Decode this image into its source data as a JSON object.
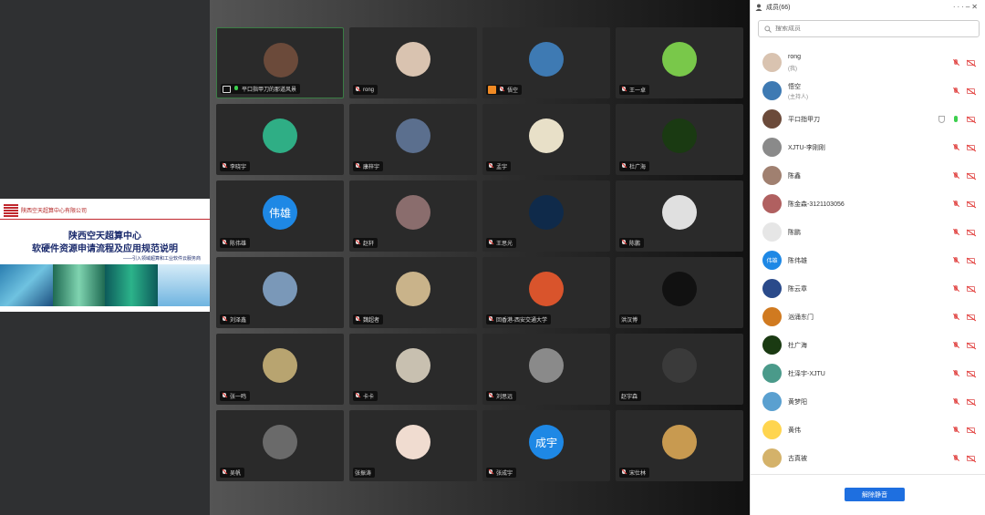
{
  "slide": {
    "company": "陕西空天超算中心有限公司",
    "title_line1": "陕西空天超算中心",
    "title_line2": "软硬件资源申请流程及应用规范说明",
    "subtitle": "——引入领域超算和工业软件云服务商"
  },
  "video_grid": {
    "tiles": [
      {
        "name": "平口指甲刀的那道风景",
        "avatar_bg": "#6b4a3a",
        "active": true,
        "pc_badge": true,
        "mic": "on"
      },
      {
        "name": "rong",
        "avatar_bg": "#d9c3b0",
        "mic": "off"
      },
      {
        "name": "悟空",
        "avatar_bg": "#3e7ab3",
        "orange_badge": true,
        "mic": "off"
      },
      {
        "name": "王一卓",
        "avatar_bg": "#79c84a",
        "mic": "off"
      },
      {
        "name": "李晓宇",
        "avatar_bg": "#2fae85",
        "mic": "off"
      },
      {
        "name": "康梓宇",
        "avatar_bg": "#5b6f8e",
        "mic": "off"
      },
      {
        "name": "孟宇",
        "avatar_bg": "#e8e0c8",
        "mic": "off"
      },
      {
        "name": "杜广海",
        "avatar_bg": "#1a3a12",
        "mic": "off"
      },
      {
        "name": "陈伟雄",
        "avatar_bg": "#1e88e5",
        "avatar_text": "伟雄",
        "mic": "off"
      },
      {
        "name": "赵轩",
        "avatar_bg": "#8a6d6d",
        "mic": "off"
      },
      {
        "name": "王思光",
        "avatar_bg": "#0f2a4a",
        "mic": "off"
      },
      {
        "name": "陈鹏",
        "avatar_bg": "#e0e0e0",
        "mic": "off"
      },
      {
        "name": "刘泽鑫",
        "avatar_bg": "#7a98b8",
        "mic": "off"
      },
      {
        "name": "魏超者",
        "avatar_bg": "#c9b38a",
        "mic": "off"
      },
      {
        "name": "回香港-西安交通大学",
        "avatar_bg": "#d9542c",
        "mic": "off"
      },
      {
        "name": "洪汉博",
        "avatar_bg": "#111111",
        "mic": "none"
      },
      {
        "name": "张一鸣",
        "avatar_bg": "#b8a470",
        "mic": "off"
      },
      {
        "name": "卡卡",
        "avatar_bg": "#c8c0b0",
        "mic": "off"
      },
      {
        "name": "刘思远",
        "avatar_bg": "#8a8a8a",
        "mic": "off"
      },
      {
        "name": "赵宇森",
        "avatar_bg": "#3a3a3a",
        "mic": "none"
      },
      {
        "name": "吴帆",
        "avatar_bg": "#6a6a6a",
        "mic": "off"
      },
      {
        "name": "张振涛",
        "avatar_bg": "#f0dcd0",
        "mic": "none"
      },
      {
        "name": "张成宇",
        "avatar_bg": "#1e88e5",
        "avatar_text": "成宇",
        "mic": "off"
      },
      {
        "name": "宋仕林",
        "avatar_bg": "#c89a50",
        "mic": "off"
      }
    ]
  },
  "members_panel": {
    "title": "成员(66)",
    "search_placeholder": "搜索成员",
    "members": [
      {
        "name": "rong",
        "sub": "(我)",
        "avatar_bg": "#d9c3b0"
      },
      {
        "name": "悟空",
        "sub": "(主持人)",
        "avatar_bg": "#3e7ab3"
      },
      {
        "name": "平口指甲刀",
        "avatar_bg": "#6b4a3a",
        "speaking": true
      },
      {
        "name": "XJTU-李刚刚",
        "avatar_bg": "#8a8a8a"
      },
      {
        "name": "陈鑫",
        "avatar_bg": "#a08070"
      },
      {
        "name": "陈金森-3121103056",
        "avatar_bg": "#b06060"
      },
      {
        "name": "陈鹏",
        "avatar_bg": "#e6e6e6"
      },
      {
        "name": "陈伟雄",
        "avatar_bg": "#1e88e5",
        "avatar_text": "伟雄"
      },
      {
        "name": "陈云章",
        "avatar_bg": "#2a4a8a"
      },
      {
        "name": "汹涌东门",
        "avatar_bg": "#d07a20"
      },
      {
        "name": "杜广海",
        "avatar_bg": "#1a3a12"
      },
      {
        "name": "杜泽宇-XJTU",
        "avatar_bg": "#4a9a8a"
      },
      {
        "name": "黄梦阳",
        "avatar_bg": "#5aa0d0"
      },
      {
        "name": "黄伟",
        "avatar_bg": "#ffd54f"
      },
      {
        "name": "古真被",
        "avatar_bg": "#d4b26a"
      }
    ],
    "unmute_label": "解除静音"
  }
}
